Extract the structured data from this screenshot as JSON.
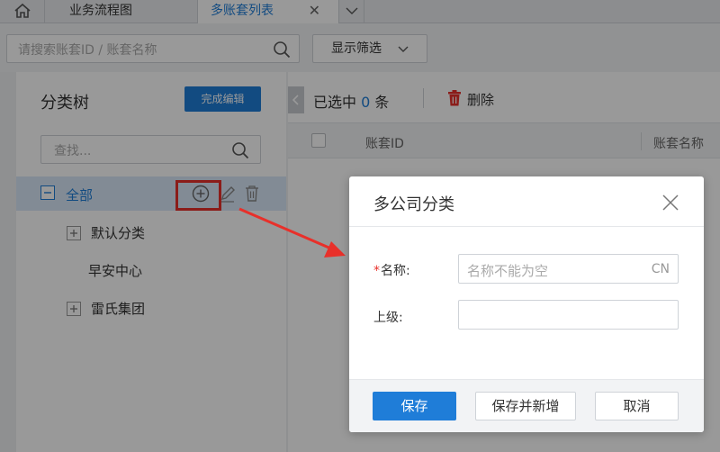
{
  "tabs": {
    "home_icon": "home-icon",
    "items": [
      {
        "label": "业务流程图"
      },
      {
        "label": "多账套列表",
        "close": "✕"
      }
    ],
    "more_icon": "chevron-down-icon"
  },
  "search": {
    "placeholder": "请搜索账套ID / 账套名称",
    "filter_label": "显示筛选"
  },
  "tree": {
    "title": "分类树",
    "done_label": "完成编辑",
    "search_placeholder": "查找...",
    "root_label": "全部",
    "children": [
      {
        "label": "默认分类",
        "expandable": true
      },
      {
        "label": "早安中心",
        "expandable": false
      },
      {
        "label": "雷氏集团",
        "expandable": true
      }
    ]
  },
  "list": {
    "selected_prefix": "已选中",
    "selected_count": "0",
    "selected_suffix": "条",
    "delete_label": "删除",
    "columns": [
      "账套ID",
      "账套名称"
    ]
  },
  "modal": {
    "title": "多公司分类",
    "name_label": "名称:",
    "name_required_mark": "*",
    "name_placeholder": "名称不能为空",
    "name_lang": "CN",
    "parent_label": "上级:",
    "parent_value": "",
    "buttons": {
      "save": "保存",
      "save_new": "保存并新增",
      "cancel": "取消"
    }
  },
  "colors": {
    "primary": "#1f7dd8",
    "annotation": "#e8302a"
  }
}
